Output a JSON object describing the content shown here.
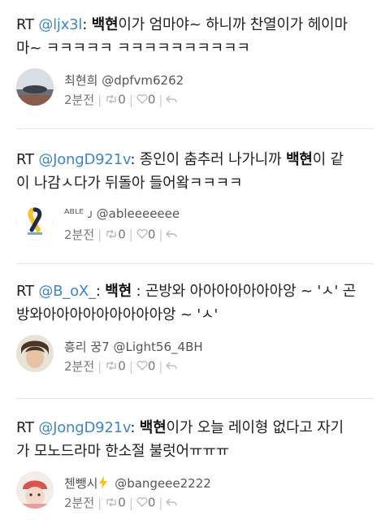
{
  "colors": {
    "mention": "#3b87c9",
    "meta": "#777777",
    "divider": "#e6e6e6"
  },
  "tweets": [
    {
      "rt": "RT ",
      "mention": "@ljx3l",
      "colon": ": ",
      "keyword": "백현",
      "line1_rest": "이가 엄마야~ 하니까 찬열이가 헤이마",
      "line2": "마~ ㅋㅋㅋㅋㅋ ㅋㅋㅋㅋㅋㅋㅋㅋㅋㅋ",
      "user_name": "최현희",
      "user_handle": "@dpfvm6262",
      "time": "2분전",
      "rt_count": "0",
      "like_count": "0"
    },
    {
      "rt": "RT ",
      "mention": "@JongD921v",
      "colon": ": 종인이 춤추러 나가니까 ",
      "keyword": "백현",
      "line1_rest": "이 같",
      "line2": "이 나감ㅅ다가 뒤돌아 들어왘ㅋㅋㅋㅋ",
      "user_name": "ᴬᴮᴸᴱ ᴊ",
      "user_handle": "@ableeeeeee",
      "time": "2분전",
      "rt_count": "0",
      "like_count": "0"
    },
    {
      "rt": "RT ",
      "mention": "@B_oX_",
      "colon": ": ",
      "keyword": "백현",
      "line1_rest": " : 곤방와 아아아아아아아앙 ~ 'ㅅ' 곤",
      "line2": "방와아아아아아아아아아앙 ~ 'ㅅ'",
      "user_name": "흥리 꿍7",
      "user_handle": "@Light56_4BH",
      "time": "2분전",
      "rt_count": "0",
      "like_count": "0"
    },
    {
      "rt": "RT ",
      "mention": "@JongD921v",
      "colon": ": ",
      "keyword": "백현",
      "line1_rest": "이가 오늘 레이형 없다고 자기",
      "line2": "가 모노드라마 한소절 불럿어ㅠㅠㅠ",
      "user_name": "첸뺑시",
      "user_handle": "@bangeee2222",
      "time": "2분전",
      "rt_count": "0",
      "like_count": "0"
    }
  ]
}
